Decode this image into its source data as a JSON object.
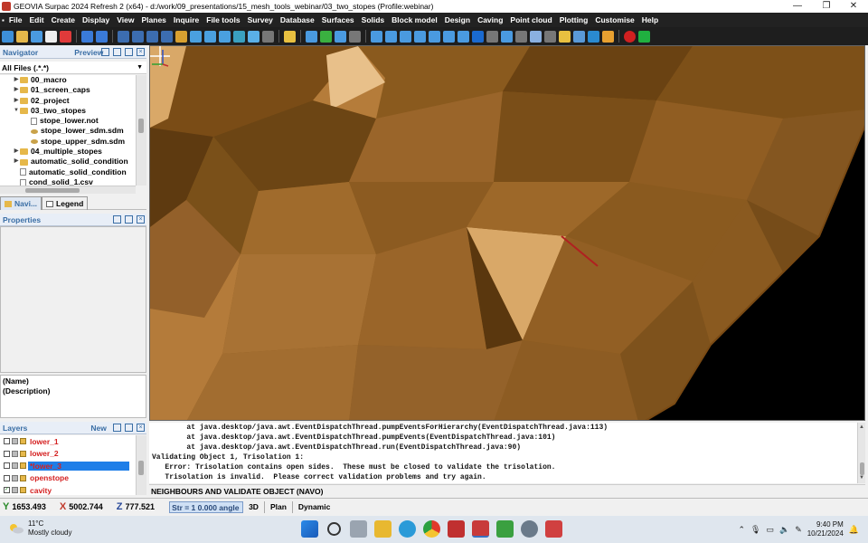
{
  "titlebar": {
    "title": "GEOVIA Surpac 2024 Refresh 2 (x64) - d:/work/09_presentations/15_mesh_tools_webinar/03_two_stopes (Profile:webinar)",
    "minimize": "—",
    "maximize": "❐",
    "close": "✕"
  },
  "menubar": {
    "items": [
      "File",
      "Edit",
      "Create",
      "Display",
      "View",
      "Planes",
      "Inquire",
      "File tools",
      "Survey",
      "Database",
      "Surfaces",
      "Solids",
      "Block model",
      "Design",
      "Caving",
      "Point cloud",
      "Plotting",
      "Customise",
      "Help"
    ]
  },
  "navigator": {
    "title": "Navigator",
    "preview": "Preview",
    "filter": "All Files (.*.*)",
    "tree": [
      {
        "label": "00_macro",
        "type": "folder",
        "expand": "▶",
        "indent": 1
      },
      {
        "label": "01_screen_caps",
        "type": "folder",
        "expand": "▶",
        "indent": 1
      },
      {
        "label": "02_project",
        "type": "folder",
        "expand": "▶",
        "indent": 1
      },
      {
        "label": "03_two_stopes",
        "type": "folder",
        "expand": "▼",
        "indent": 1
      },
      {
        "label": "stope_lower.not",
        "type": "file",
        "expand": "",
        "indent": 2
      },
      {
        "label": "stope_lower_sdm.sdm",
        "type": "sdm",
        "expand": "",
        "indent": 2
      },
      {
        "label": "stope_upper_sdm.sdm",
        "type": "sdm",
        "expand": "",
        "indent": 2
      },
      {
        "label": "04_multiple_stopes",
        "type": "folder",
        "expand": "▶",
        "indent": 1
      },
      {
        "label": "automatic_solid_condition",
        "type": "folder",
        "expand": "▶",
        "indent": 1
      },
      {
        "label": "automatic_solid_condition",
        "type": "file",
        "expand": "",
        "indent": 1
      },
      {
        "label": "cond_solid_1.csv",
        "type": "file",
        "expand": "",
        "indent": 1
      }
    ],
    "tabs": {
      "navi": "Navi...",
      "legend": "Legend"
    }
  },
  "properties": {
    "title": "Properties",
    "name": "(Name)",
    "description": "(Description)"
  },
  "layers": {
    "title": "Layers",
    "new": "New",
    "rows": [
      {
        "name": "lower_1",
        "checked": false,
        "selected": false
      },
      {
        "name": "lower_2",
        "checked": false,
        "selected": false
      },
      {
        "name": "*lower_3",
        "checked": false,
        "selected": true
      },
      {
        "name": "openstope",
        "checked": false,
        "selected": false
      },
      {
        "name": "cavity",
        "checked": true,
        "selected": false
      }
    ]
  },
  "console": {
    "lines": [
      "        at java.desktop/java.awt.EventDispatchThread.pumpEventsForHierarchy(EventDispatchThread.java:113)",
      "        at java.desktop/java.awt.EventDispatchThread.pumpEvents(EventDispatchThread.java:101)",
      "        at java.desktop/java.awt.EventDispatchThread.run(EventDispatchThread.java:90)",
      "Validating Object 1, Trisolation 1:",
      "   Error: Trisolation contains open sides.  These must be closed to validate the trisolation.",
      "   Trisolation is invalid.  Please correct validation problems and try again."
    ],
    "command": "NEIGHBOURS AND VALIDATE OBJECT (NAVO)"
  },
  "status": {
    "y_label": "Y",
    "y": "1653.493",
    "x_label": "X",
    "x": "5002.744",
    "z_label": "Z",
    "z": "777.521",
    "str": "Str = 1 0.000 angle",
    "mode_3d": "3D",
    "plan": "Plan",
    "dynamic": "Dynamic"
  },
  "taskbar": {
    "temp": "11°C",
    "weather": "Mostly cloudy",
    "time": "9:40 PM",
    "date": "10/21/2024"
  },
  "colors": {
    "menubar_bg": "#222222",
    "mesh_base": "#8a5a1e",
    "layer_name": "#d42020",
    "selection": "#1e7ee8",
    "accent_blue": "#3a6ea5"
  }
}
